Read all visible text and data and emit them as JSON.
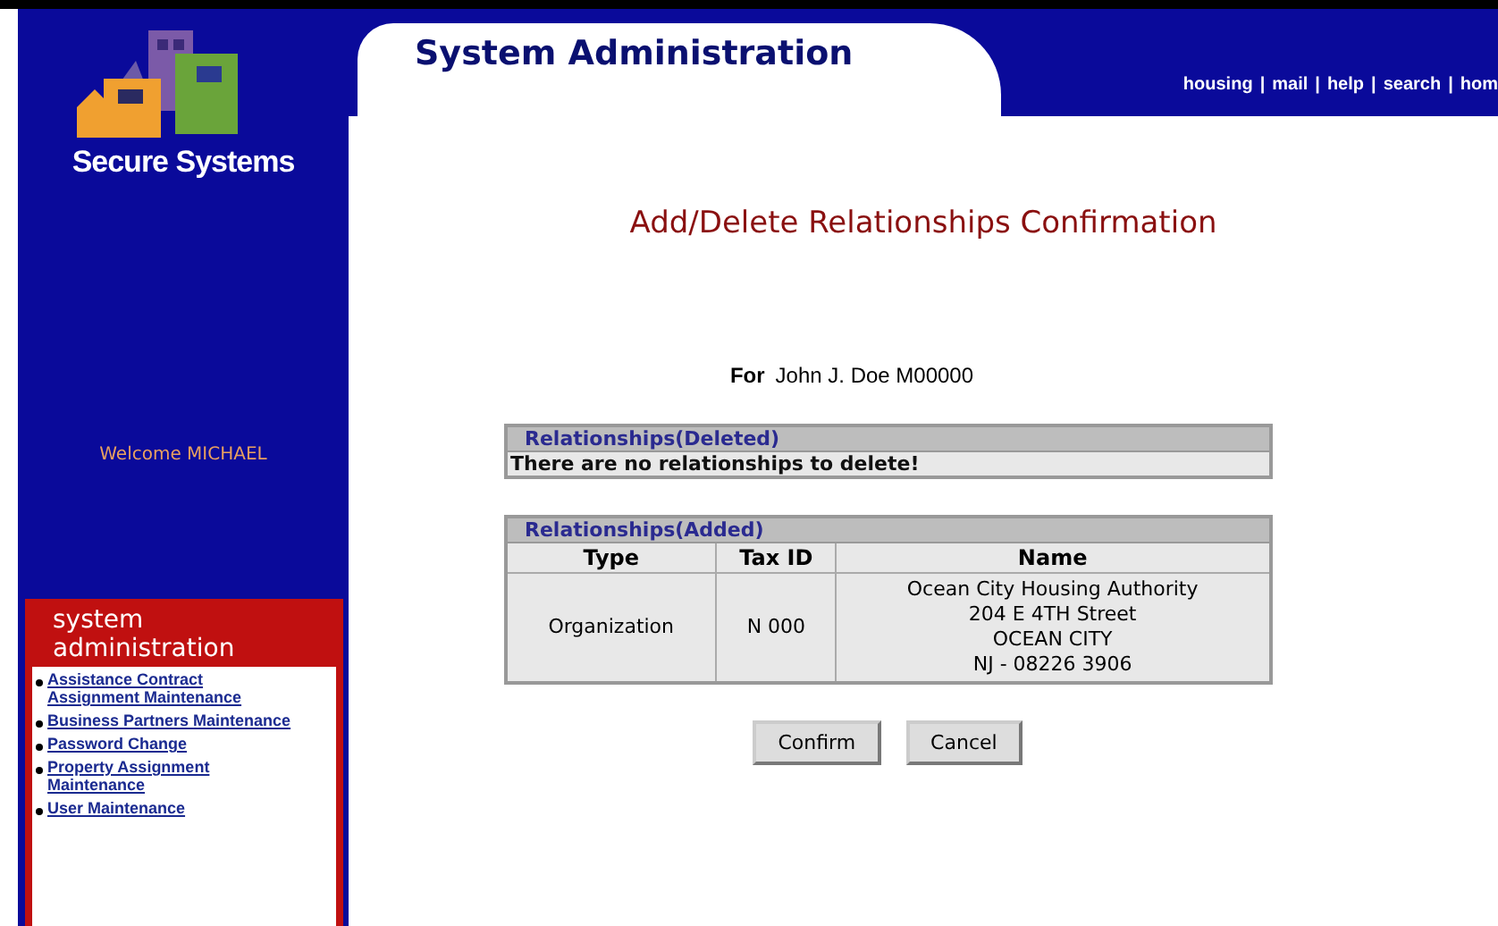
{
  "sidebar": {
    "brand": "Secure Systems",
    "welcome": "Welcome MICHAEL",
    "menu_title": "system administration",
    "menu_items": [
      {
        "label": "Assistance Contract Assignment Maintenance"
      },
      {
        "label": "Business Partners Maintenance"
      },
      {
        "label": "Password Change"
      },
      {
        "label": "Property Assignment Maintenance"
      },
      {
        "label": "User Maintenance"
      }
    ]
  },
  "header": {
    "title": "System Administration",
    "separator": "|",
    "links": [
      "housing",
      "mail",
      "help",
      "search",
      "hom"
    ]
  },
  "heading": "Add/Delete Relationships Confirmation",
  "for_label": "For",
  "for_value": "John J. Doe M00000",
  "deleted": {
    "title": "Relationships(Deleted)",
    "message": "There are no relationships to delete!"
  },
  "added": {
    "title": "Relationships(Added)",
    "columns": [
      "Type",
      "Tax ID",
      "Name"
    ],
    "rows": [
      {
        "type": "Organization",
        "tax_id": "N 000",
        "name_lines": [
          "Ocean City Housing Authority",
          "204 E 4TH Street",
          "OCEAN CITY",
          "NJ - 08226 3906"
        ]
      }
    ]
  },
  "buttons": [
    "Confirm",
    "Cancel"
  ]
}
